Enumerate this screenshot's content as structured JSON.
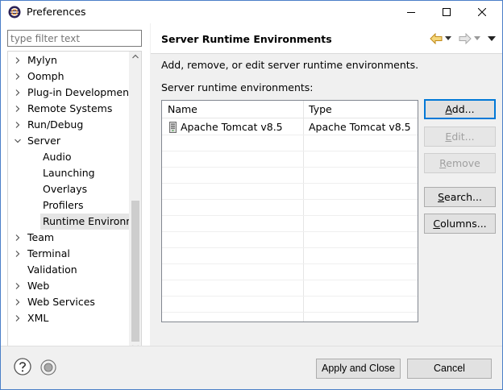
{
  "window": {
    "title": "Preferences",
    "minimize_icon": "minimize-icon",
    "maximize_icon": "maximize-icon",
    "close_icon": "close-icon"
  },
  "filter": {
    "placeholder": "type filter text"
  },
  "tree": [
    {
      "label": "Mylyn",
      "expander": "collapsed",
      "level": 0
    },
    {
      "label": "Oomph",
      "expander": "collapsed",
      "level": 0
    },
    {
      "label": "Plug-in Development",
      "expander": "collapsed",
      "level": 0
    },
    {
      "label": "Remote Systems",
      "expander": "collapsed",
      "level": 0
    },
    {
      "label": "Run/Debug",
      "expander": "collapsed",
      "level": 0
    },
    {
      "label": "Server",
      "expander": "expanded",
      "level": 0
    },
    {
      "label": "Audio",
      "expander": "none",
      "level": 1
    },
    {
      "label": "Launching",
      "expander": "none",
      "level": 1
    },
    {
      "label": "Overlays",
      "expander": "none",
      "level": 1
    },
    {
      "label": "Profilers",
      "expander": "none",
      "level": 1
    },
    {
      "label": "Runtime Environm",
      "expander": "none",
      "level": 1,
      "selected": true
    },
    {
      "label": "Team",
      "expander": "collapsed",
      "level": 0
    },
    {
      "label": "Terminal",
      "expander": "collapsed",
      "level": 0
    },
    {
      "label": "Validation",
      "expander": "none",
      "level": 0
    },
    {
      "label": "Web",
      "expander": "collapsed",
      "level": 0
    },
    {
      "label": "Web Services",
      "expander": "collapsed",
      "level": 0
    },
    {
      "label": "XML",
      "expander": "collapsed",
      "level": 0
    }
  ],
  "page": {
    "title": "Server Runtime Environments",
    "description": "Add, remove, or edit server runtime environments.",
    "list_label": "Server runtime environments:",
    "back_icon": "back-arrow-icon",
    "forward_icon": "forward-arrow-icon",
    "menu_icon": "view-menu-icon"
  },
  "table": {
    "columns": [
      "Name",
      "Type"
    ],
    "rows": [
      {
        "name": "Apache Tomcat v8.5",
        "type": "Apache Tomcat v8.5",
        "icon": "server-icon"
      }
    ]
  },
  "buttons": {
    "add": "Add...",
    "edit": "Edit...",
    "remove": "Remove",
    "search": "Search...",
    "columns": "Columns..."
  },
  "footer": {
    "apply_close": "Apply and Close",
    "cancel": "Cancel",
    "help_icon": "help-icon",
    "import_icon": "import-export-icon"
  },
  "colors": {
    "accent": "#0078d7",
    "border": "#4b7fc8",
    "selection": "#e5e5e5"
  }
}
